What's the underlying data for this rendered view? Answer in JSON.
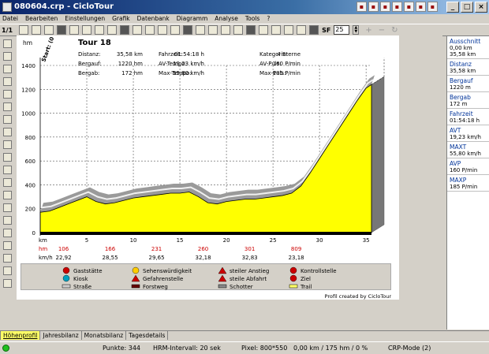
{
  "window": {
    "title": "080604.crp - CicloTour"
  },
  "menu": [
    "Datei",
    "Bearbeiten",
    "Einstellungen",
    "Grafik",
    "Datenbank",
    "Diagramm",
    "Analyse",
    "Tools",
    "?"
  ],
  "toolbar": {
    "page": "1/1",
    "sf_label": "SF",
    "sf_value": "25"
  },
  "chart": {
    "tour": "Tour 18",
    "y_unit": "hm",
    "start_label": "Start: (0",
    "stats": [
      [
        "Distanz:",
        "35,58 km",
        "Fahrzeit:",
        "01:54:18 h",
        "Kategorie:",
        "4 Sterne"
      ],
      [
        "Bergauf:",
        "1220 hm",
        "AV-Tempo:",
        "19,23 km/h",
        "AV-Puls:",
        "160 P/min"
      ],
      [
        "Bergab:",
        "172 hm",
        "Max-Tempo:",
        "55,80 km/h",
        "Max-Puls:",
        "185 P/min"
      ]
    ],
    "row_km_label": "km",
    "row_hm_label": "hm",
    "row_kmh_label": "km/h",
    "hm_values": [
      "106",
      "166",
      "231",
      "260",
      "301",
      "809"
    ],
    "kmh_values": [
      "22,92",
      "28,55",
      "29,65",
      "32,18",
      "32,83",
      "23,18"
    ],
    "credit": "Profil created by CicloTour"
  },
  "chart_data": {
    "type": "area",
    "xlabel": "km",
    "ylabel": "hm",
    "xlim": [
      0,
      35.58
    ],
    "ylim": [
      0,
      1400
    ],
    "x_ticks": [
      5,
      10,
      15,
      20,
      25,
      30,
      35
    ],
    "y_ticks": [
      0,
      200,
      400,
      600,
      800,
      1000,
      1200,
      1400
    ],
    "x": [
      0,
      1,
      2,
      3,
      4,
      5,
      6,
      7,
      8,
      9,
      10,
      11,
      12,
      13,
      14,
      15,
      16,
      17,
      18,
      19,
      20,
      21,
      22,
      23,
      24,
      25,
      26,
      27,
      28,
      29,
      30,
      31,
      32,
      33,
      34,
      35,
      35.58
    ],
    "y": [
      170,
      180,
      210,
      240,
      270,
      300,
      260,
      240,
      250,
      270,
      290,
      300,
      310,
      320,
      330,
      330,
      340,
      300,
      250,
      240,
      260,
      270,
      280,
      280,
      290,
      300,
      310,
      330,
      390,
      500,
      620,
      740,
      860,
      980,
      1100,
      1210,
      1240
    ],
    "series": [
      {
        "name": "Höhe",
        "color": "#ffff00"
      }
    ]
  },
  "legend": [
    [
      {
        "icon": "house-icon",
        "label": "Gaststätte"
      },
      {
        "icon": "smiley-icon",
        "label": "Sehenswürdigkeit"
      },
      {
        "icon": "warning-triangle-icon",
        "label": "steiler Anstieg"
      },
      {
        "icon": "control-icon",
        "label": "Kontrollstelle"
      }
    ],
    [
      {
        "icon": "kiosk-icon",
        "label": "Kiosk"
      },
      {
        "icon": "danger-icon",
        "label": "Gefahrenstelle"
      },
      {
        "icon": "steep-descent-icon",
        "label": "steile Abfahrt"
      },
      {
        "icon": "goal-flag-icon",
        "label": "Ziel"
      }
    ],
    [
      {
        "icon": "street-icon",
        "label": "Straße"
      },
      {
        "icon": "forest-road-icon",
        "label": "Forstweg"
      },
      {
        "icon": "gravel-icon",
        "label": "Schotter"
      },
      {
        "icon": "trail-icon",
        "label": "Trail"
      }
    ]
  ],
  "sidebar": [
    {
      "label": "Ausschnitt",
      "values": [
        "0,00 km",
        "35,58 km"
      ]
    },
    {
      "label": "Distanz",
      "values": [
        "35,58 km"
      ]
    },
    {
      "label": "Bergauf",
      "values": [
        "1220 m"
      ]
    },
    {
      "label": "Bergab",
      "values": [
        "172 m"
      ]
    },
    {
      "label": "Fahrzeit",
      "values": [
        "01:54:18 h"
      ]
    },
    {
      "label": "AVT",
      "values": [
        "19,23 km/h"
      ]
    },
    {
      "label": "MAXT",
      "values": [
        "55,80 km/h"
      ]
    },
    {
      "label": "AVP",
      "values": [
        "160 P/min"
      ]
    },
    {
      "label": "MAXP",
      "values": [
        "185 P/min"
      ]
    }
  ],
  "tabs": [
    "Höhenprofil",
    "Jahresbilanz",
    "Monatsbilanz",
    "Tagesdetails"
  ],
  "status": {
    "points": "Punkte: 344",
    "hrm": "HRM-Intervall: 20 sek",
    "pixel": "Pixel: 800*550",
    "pos": "0,00 km / 175 hm / 0 %",
    "mode": "CRP-Mode (2)"
  }
}
